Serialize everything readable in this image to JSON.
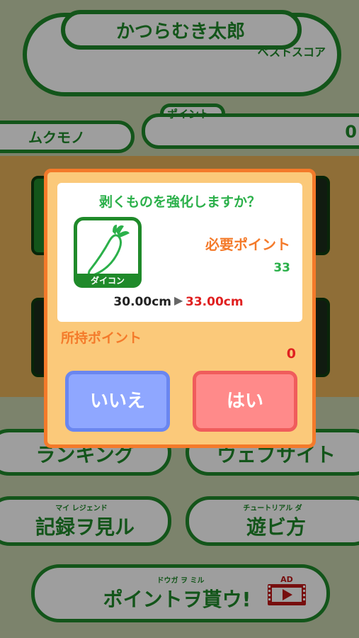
{
  "header": {
    "title": "かつらむき太郎",
    "best_score_label": "ベストスコア"
  },
  "status_bar": {
    "item_label": "ムクモノ",
    "points_label": "ポイント",
    "points_value": "0"
  },
  "menu": {
    "ranking": "ランキング",
    "website": "ウェブサイト",
    "records": "記録ヲ見ル",
    "records_ruby": "マイ レジェンド",
    "howto": "遊ビ方",
    "howto_ruby": "チュートリアル ダ",
    "get_points": "ポイントヲ貰ウ!",
    "get_points_ruby": "ドウガ ヲ ミル",
    "ad_badge": "AD"
  },
  "dialog": {
    "question": "剥くものを強化しますか？",
    "item_name": "ダイコン",
    "required_label": "必要ポイント",
    "required_value": "33",
    "size_from": "30.00cm",
    "size_to": "33.00cm",
    "owned_label": "所持ポイント",
    "owned_value": "0",
    "no_label": "いいえ",
    "yes_label": "はい"
  },
  "colors": {
    "brand_green": "#1f8a2a",
    "accent_orange": "#f47a2a",
    "no_button": "#8fa7ff",
    "yes_button": "#ff8a8a"
  }
}
